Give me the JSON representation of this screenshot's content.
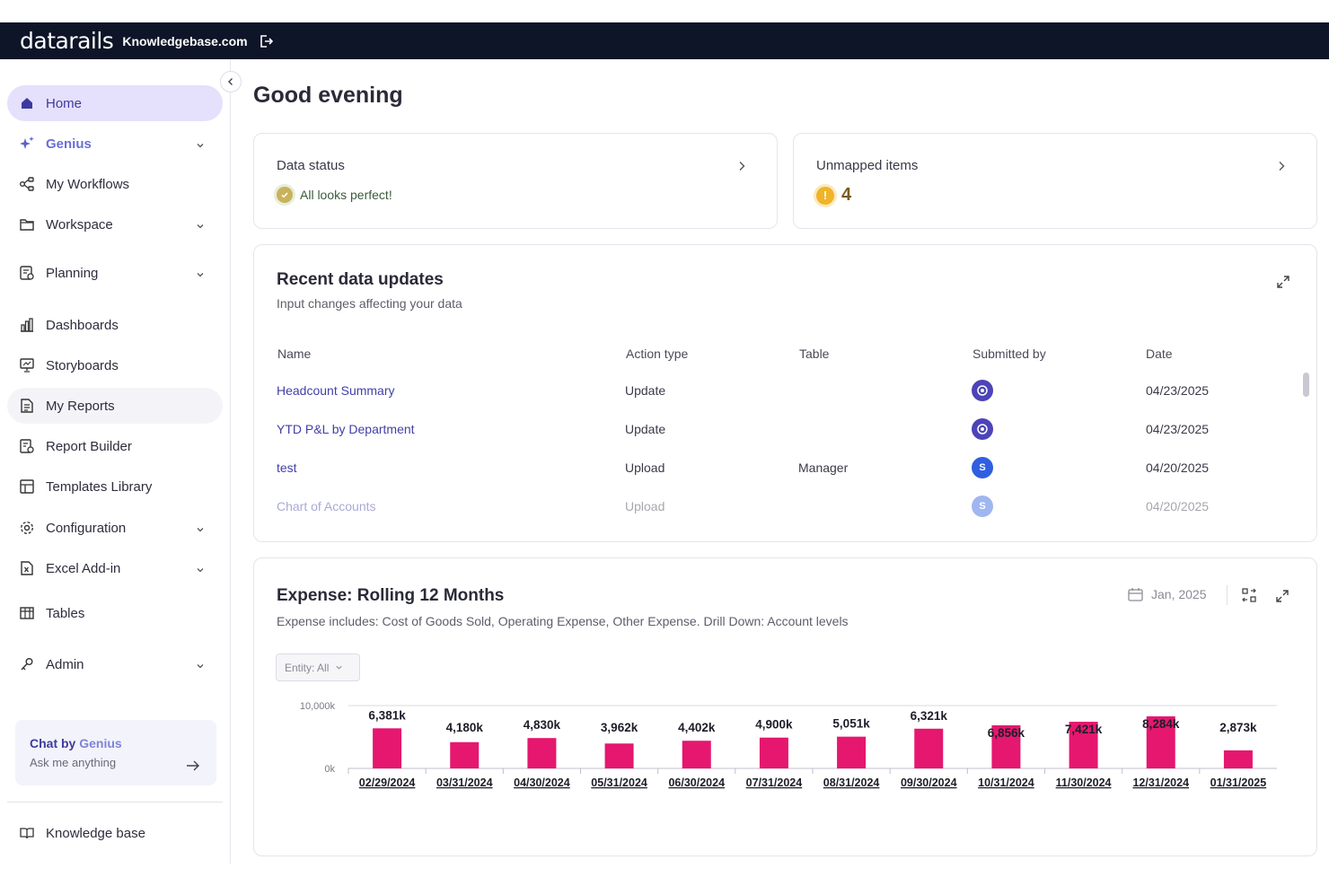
{
  "topbar": {
    "logo": "datarails",
    "company": "Knowledgebase.com"
  },
  "sidebar": {
    "items": [
      {
        "label": "Home"
      },
      {
        "label": "Genius"
      },
      {
        "label": "My Workflows"
      },
      {
        "label": "Workspace"
      },
      {
        "label": "Planning"
      },
      {
        "label": "Dashboards"
      },
      {
        "label": "Storyboards"
      },
      {
        "label": "My Reports"
      },
      {
        "label": "Report Builder"
      },
      {
        "label": "Templates Library"
      },
      {
        "label": "Configuration"
      },
      {
        "label": "Excel Add-in"
      },
      {
        "label": "Tables"
      },
      {
        "label": "Admin"
      }
    ],
    "chat": {
      "title_a": "Chat by ",
      "title_b": "Genius",
      "placeholder": "Ask me anything"
    },
    "knowledge_base": "Knowledge base"
  },
  "main": {
    "greeting": "Good evening",
    "data_status": {
      "title": "Data status",
      "message": "All looks perfect!"
    },
    "unmapped": {
      "title": "Unmapped items",
      "count": "4"
    },
    "recent": {
      "title": "Recent data updates",
      "subtitle": "Input changes affecting your data",
      "columns": [
        "Name",
        "Action type",
        "Table",
        "Submitted by",
        "Date"
      ],
      "rows": [
        {
          "name": "Headcount Summary",
          "action": "Update",
          "table": "",
          "avatar": "",
          "date": "04/23/2025"
        },
        {
          "name": "YTD P&L by Department",
          "action": "Update",
          "table": "",
          "avatar": "",
          "date": "04/23/2025"
        },
        {
          "name": "test",
          "action": "Upload",
          "table": "Manager",
          "avatar": "S",
          "date": "04/20/2025"
        },
        {
          "name": "Chart of Accounts",
          "action": "Upload",
          "table": "",
          "avatar": "S",
          "date": "04/20/2025"
        }
      ]
    },
    "expense": {
      "title": "Expense: Rolling 12 Months",
      "subtitle": "Expense includes: Cost of Goods Sold, Operating Expense, Other Expense. Drill Down: Account levels",
      "entity_filter": "Entity: All",
      "date": "Jan, 2025"
    }
  },
  "colors": {
    "accent": "#3c3aa0",
    "bar": "#e5176f",
    "topbar": "#0f1528"
  },
  "chart_data": {
    "type": "bar",
    "categories": [
      "02/29/2024",
      "03/31/2024",
      "04/30/2024",
      "05/31/2024",
      "06/30/2024",
      "07/31/2024",
      "08/31/2024",
      "09/30/2024",
      "10/31/2024",
      "11/30/2024",
      "12/31/2024",
      "01/31/2025"
    ],
    "values": [
      6381,
      4180,
      4830,
      3962,
      4402,
      4900,
      5051,
      6321,
      6856,
      7421,
      8284,
      2873
    ],
    "labels": [
      "6,381k",
      "4,180k",
      "4,830k",
      "3,962k",
      "4,402k",
      "4,900k",
      "5,051k",
      "6,321k",
      "6,856k",
      "7,421k",
      "8,284k",
      "2,873k"
    ],
    "yticks": [
      "10,000k",
      "0k"
    ],
    "ylim": [
      0,
      10000
    ],
    "unit": "k",
    "grid": true
  }
}
